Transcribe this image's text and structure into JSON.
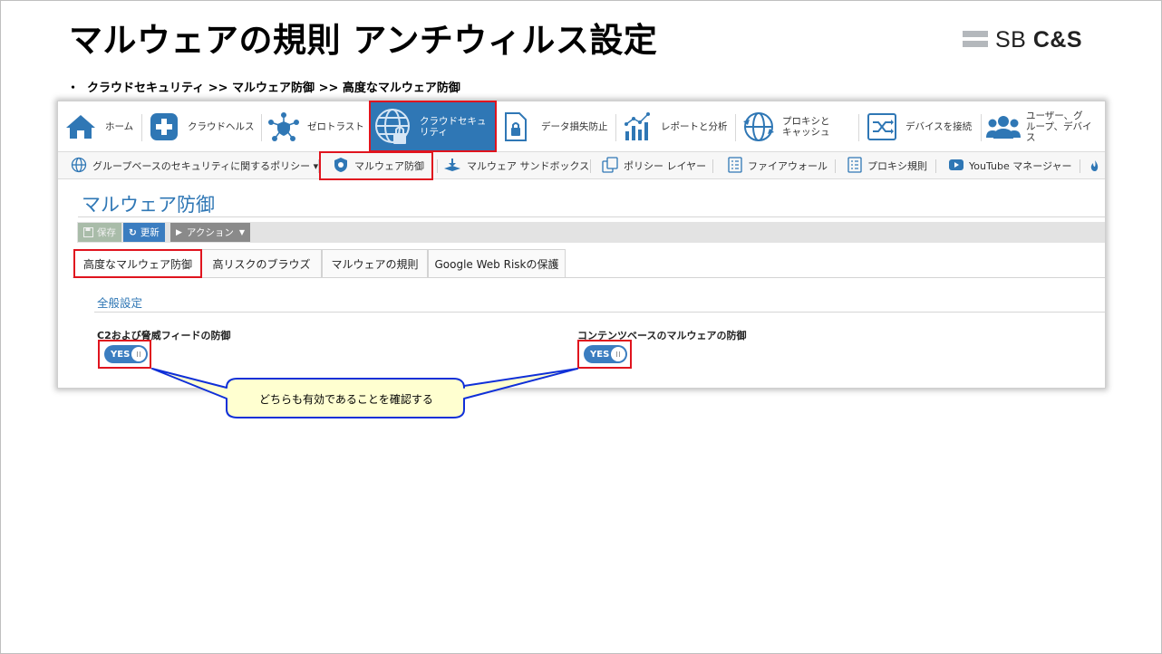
{
  "slide": {
    "title": "マルウェアの規則 アンチウィルス設定",
    "logo_sb": "SB",
    "logo_cs": "C&S",
    "bullet": "・",
    "breadcrumb": "クラウドセキュリティ >> マルウェア防御 >> 高度なマルウェア防御"
  },
  "topnav": {
    "items": [
      {
        "label": "ホーム",
        "icon": "home-icon"
      },
      {
        "label": "クラウドヘルス",
        "icon": "plus-icon"
      },
      {
        "label": "ゼロトラスト",
        "icon": "network-icon"
      },
      {
        "label_line1": "クラウドセキュ",
        "label_line2": "リティ",
        "icon": "globe-lock-icon",
        "active": true
      },
      {
        "label": "データ損失防止",
        "icon": "file-lock-icon"
      },
      {
        "label": "レポートと分析",
        "icon": "chart-icon"
      },
      {
        "label_line1": "プロキシと",
        "label_line2": "キャッシュ",
        "icon": "proxy-globe-icon"
      },
      {
        "label": "デバイスを接続",
        "icon": "shuffle-icon"
      },
      {
        "label_line1": "ユーザー、グ",
        "label_line2": "ループ、デバイ",
        "label_line3": "ス",
        "icon": "users-icon"
      }
    ]
  },
  "subnav": {
    "items": [
      {
        "label": "グループベースのセキュリティに関するポリシー ▾",
        "icon": "globe-icon"
      },
      {
        "label": "マルウェア防御",
        "icon": "shield-icon"
      },
      {
        "label": "マルウェア サンドボックス",
        "icon": "sandbox-icon"
      },
      {
        "label": "ポリシー レイヤー",
        "icon": "layers-icon"
      },
      {
        "label": "ファイアウォール",
        "icon": "checklist-icon"
      },
      {
        "label": "プロキシ規則",
        "icon": "checklist-icon"
      },
      {
        "label": "YouTube マネージャー",
        "icon": "youtube-icon"
      }
    ]
  },
  "page": {
    "heading": "マルウェア防御",
    "toolbar": {
      "save": "保存",
      "update": "更新",
      "action": "アクション"
    },
    "tabs": [
      "高度なマルウェア防御",
      "高リスクのブラウズ",
      "マルウェアの規則",
      "Google Web Riskの保護"
    ],
    "section_title": "全般設定",
    "settings": [
      {
        "label": "C2および脅威フィードの防御",
        "value": "YES"
      },
      {
        "label": "コンテンツベースのマルウェアの防御",
        "value": "YES"
      }
    ]
  },
  "callout": {
    "text": "どちらも有効であることを確認する"
  },
  "colors": {
    "accent": "#2f77b5",
    "highlight": "#e0141e",
    "callout_fill": "#ffffd0",
    "callout_border": "#1030d8"
  }
}
